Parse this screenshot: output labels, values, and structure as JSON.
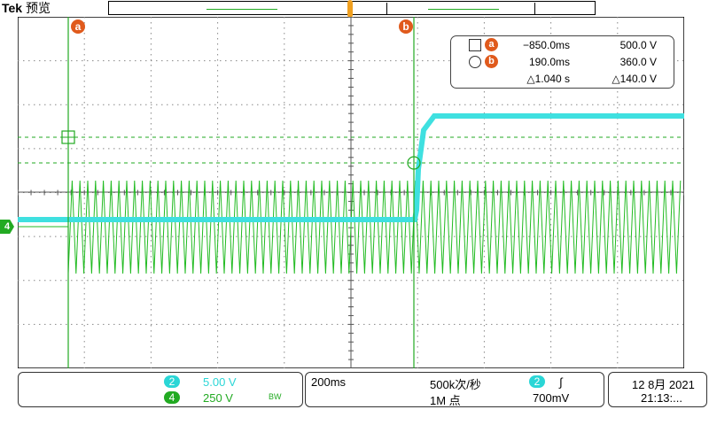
{
  "header": {
    "brand": "Tek",
    "mode": "预览"
  },
  "cursors": {
    "a_label": "a",
    "b_label": "b"
  },
  "ch4_marker": "4",
  "readout": {
    "a": {
      "label": "a",
      "time": "−850.0ms",
      "value": "500.0 V"
    },
    "b": {
      "label": "b",
      "time": "190.0ms",
      "value": "360.0 V"
    },
    "delta_time": "△1.040 s",
    "delta_value": "△140.0 V"
  },
  "channels": [
    {
      "id": "2",
      "scale": "5.00 V",
      "color": "#2ad6d6"
    },
    {
      "id": "4",
      "scale": "250 V",
      "color": "#22aa22",
      "bw": "BW"
    }
  ],
  "timebase": {
    "per_div": "200ms",
    "sample_rate": "500k次/秒",
    "record_length": "1M 点"
  },
  "trigger": {
    "channel": "2",
    "slope": "∫",
    "level": "700mV"
  },
  "clock": {
    "date": "12 8月 2021",
    "time": "21:13:..."
  }
}
